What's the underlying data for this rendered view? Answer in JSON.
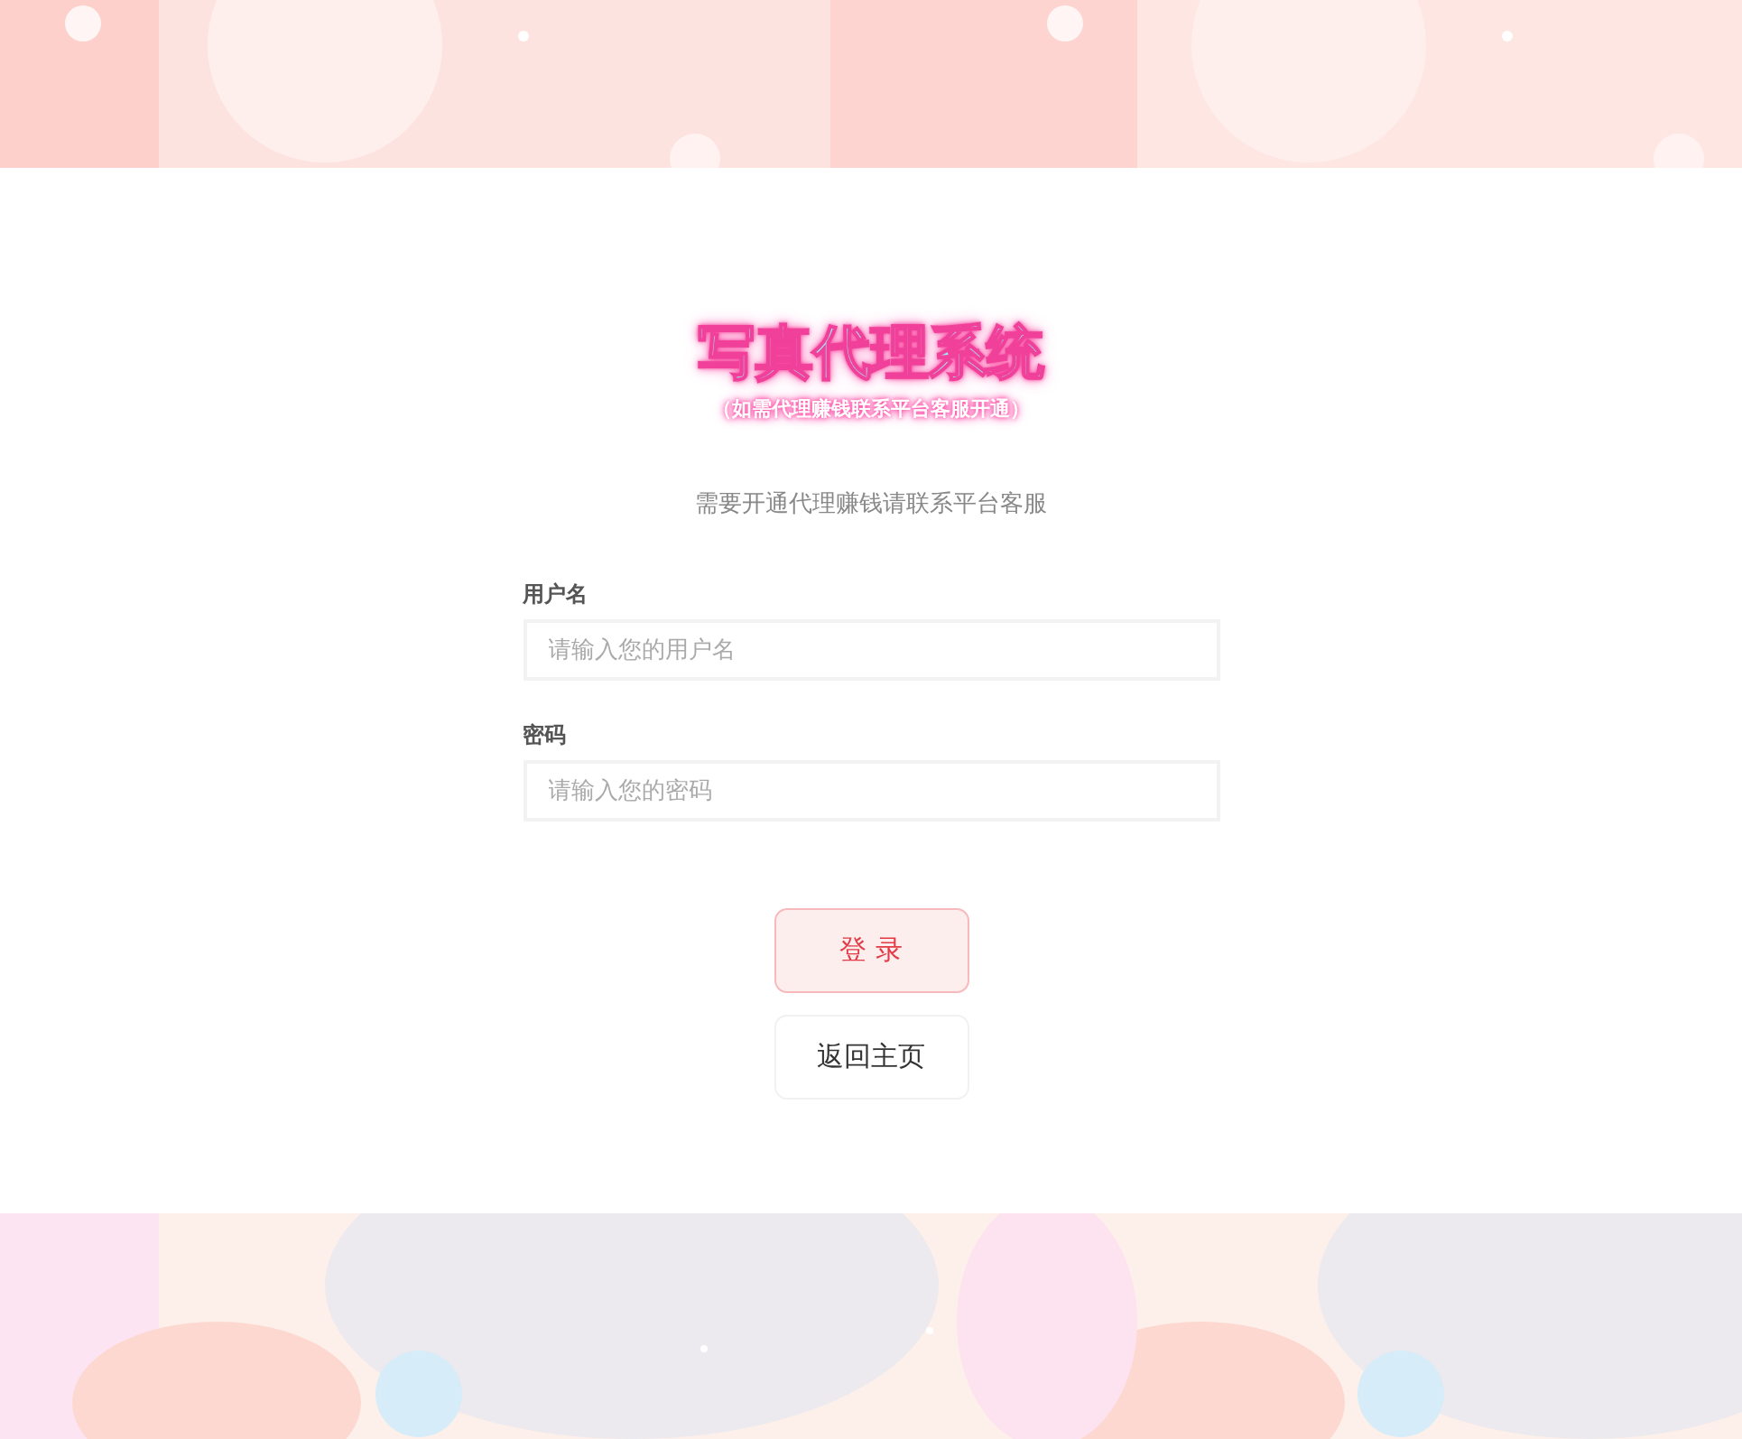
{
  "title": "写真代理系统",
  "subtitle": "（如需代理赚钱联系平台客服开通）",
  "note": "需要开通代理赚钱请联系平台客服",
  "fields": [
    {
      "label": "用户名",
      "placeholder": "请输入您的用户名"
    },
    {
      "label": "密码",
      "placeholder": "请输入您的密码"
    }
  ],
  "buttons": [
    {
      "label": "登 录",
      "kind": "primary"
    },
    {
      "label": "返回主页",
      "kind": "secondary"
    }
  ]
}
